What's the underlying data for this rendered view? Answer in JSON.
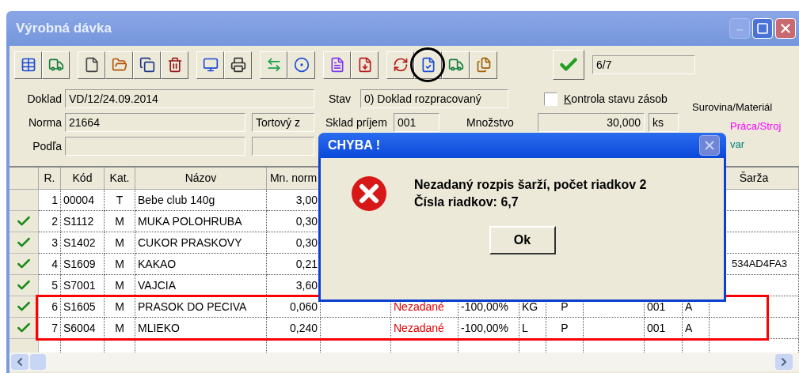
{
  "window": {
    "title": "Výrobná dávka"
  },
  "toolbar": {
    "counter": "6/7"
  },
  "form": {
    "doklad_label": "Doklad",
    "doklad": "VD/12/24.09.2014",
    "stav_label": "Stav",
    "stav": "0) Doklad rozpracovaný",
    "stock_check": {
      "label": "Kontrola stavu zásob",
      "checked": false
    },
    "norma_label": "Norma",
    "norma": "21664",
    "norma_name": "Tortový z",
    "sklad_label": "Sklad príjem",
    "sklad": "001",
    "mnozstvo_label": "Množstvo",
    "mnozstvo": "30,000",
    "unit": "ks",
    "podla_label": "Podľa"
  },
  "legend": [
    {
      "label": "Surovina/Materiál",
      "color": "#000000"
    },
    {
      "label": "Práca/Stroj",
      "color": "#ff00ff"
    },
    {
      "label": "var",
      "color": "#008080"
    }
  ],
  "table": {
    "headers": {
      "r": "R.",
      "code": "Kód",
      "category": "Kat.",
      "name": "Názov",
      "norm_qty": "Mn. norm",
      "batch": "Šarža"
    },
    "rows": [
      {
        "checked": false,
        "r": "1",
        "code": "00004",
        "category": "T",
        "name": "Bebe club 140g",
        "norm_qty": "3,00"
      },
      {
        "checked": true,
        "r": "2",
        "code": "S1112",
        "category": "M",
        "name": "MUKA POLOHRUBA",
        "norm_qty": "0,30"
      },
      {
        "checked": true,
        "r": "3",
        "code": "S1402",
        "category": "M",
        "name": "CUKOR PRASKOVY",
        "norm_qty": "0,30"
      },
      {
        "checked": true,
        "r": "4",
        "code": "S1609",
        "category": "M",
        "name": "KAKAO",
        "norm_qty": "0,21",
        "batch": "534AD4FA3"
      },
      {
        "checked": true,
        "r": "5",
        "code": "S7001",
        "category": "M",
        "name": "VAJCIA",
        "norm_qty": "3,60"
      },
      {
        "checked": true,
        "r": "6",
        "code": "S1605",
        "category": "M",
        "name": "PRASOK DO PECIVA",
        "norm_qty": "0,060",
        "status": "Nezadané",
        "percent": "-100,00%",
        "unit": "KG",
        "column_11": "P",
        "column_13": "001",
        "column_14": "A"
      },
      {
        "checked": true,
        "r": "7",
        "code": "S6004",
        "category": "M",
        "name": "MLIEKO",
        "norm_qty": "0,240",
        "status": "Nezadané",
        "percent": "-100,00%",
        "unit": "L",
        "column_11": "P",
        "column_13": "001",
        "column_14": "A"
      }
    ]
  },
  "dialog": {
    "title": "CHYBA !",
    "message": [
      "Nezadaný rozpis šarží, počet riadkov 2",
      "Čísla riadkov: 6,7"
    ],
    "button": "Ok"
  }
}
